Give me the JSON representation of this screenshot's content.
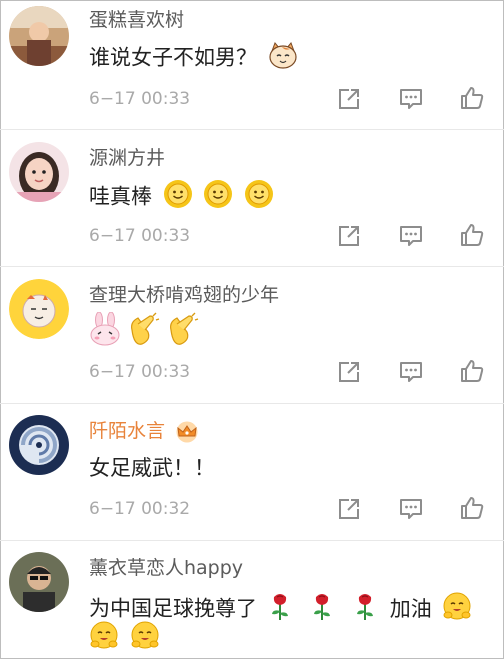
{
  "comments": [
    {
      "username": "蛋糕喜欢树",
      "text": "谁说女子不如男？",
      "time": "6−17 00:33",
      "emojis": [
        "cat-emoji"
      ]
    },
    {
      "username": "源渊方井",
      "text": "哇真棒",
      "time": "6−17 00:33",
      "emojis": [
        "sun-smile-emoji",
        "sun-smile-emoji",
        "sun-smile-emoji"
      ]
    },
    {
      "username": "查理大桥啃鸡翅的少年",
      "text": "",
      "time": "6−17 00:33",
      "emojis": [
        "bunny-emoji",
        "clap-emoji",
        "clap-emoji"
      ]
    },
    {
      "username": "阡陌水言",
      "text": "女足威武！！",
      "time": "6−17 00:32",
      "emojis": [],
      "badge": "crown-badge-icon"
    },
    {
      "username": "薰衣草恋人happy",
      "text": "为中国足球挽尊了",
      "text_after": "加油",
      "time": "",
      "emojis": [
        "rose-emoji",
        "rose-emoji",
        "rose-emoji"
      ]
    }
  ],
  "actions": [
    "share-icon",
    "comment-icon",
    "like-icon"
  ],
  "colors": {
    "name": "#5b5b5b",
    "vip_name": "#e8833a",
    "time": "#a9a9a9",
    "icon": "#8d8d8d"
  }
}
